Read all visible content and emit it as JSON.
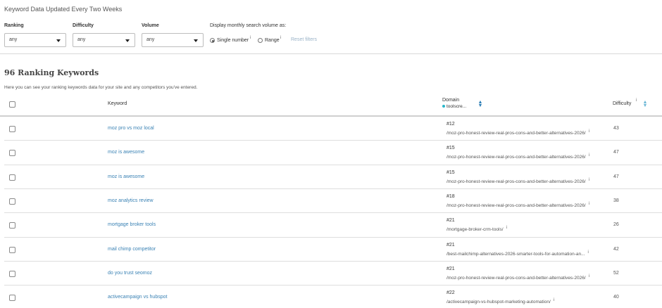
{
  "header": {
    "title": "Keyword Data Updated Every Two Weeks"
  },
  "filters": {
    "ranking": {
      "label": "Ranking",
      "value": "any"
    },
    "difficulty": {
      "label": "Difficulty",
      "value": "any"
    },
    "volume": {
      "label": "Volume",
      "value": "any"
    },
    "display_label": "Display monthly search volume as:",
    "single_number": "Single number",
    "range": "Range",
    "info": "i",
    "reset": "Reset filters"
  },
  "section": {
    "title": "96 Ranking Keywords",
    "description": "Here you can see your ranking keywords data for your site and any competitors you've entered."
  },
  "table": {
    "headers": {
      "keyword": "Keyword",
      "domain": "Domain",
      "domain_sub": "toolscre...",
      "difficulty": "Difficulty"
    },
    "rows": [
      {
        "keyword": "moz pro vs moz local",
        "rank": "#12",
        "url": "/moz-pro-honest-review-real-pros-cons-and-better-alternatives-2026/",
        "difficulty": "43"
      },
      {
        "keyword": "moz is awesome",
        "rank": "#15",
        "url": "/moz-pro-honest-review-real-pros-cons-and-better-alternatives-2026/",
        "difficulty": "47"
      },
      {
        "keyword": "moz is awesome",
        "rank": "#15",
        "url": "/moz-pro-honest-review-real-pros-cons-and-better-alternatives-2026/",
        "difficulty": "47"
      },
      {
        "keyword": "moz analytics review",
        "rank": "#18",
        "url": "/moz-pro-honest-review-real-pros-cons-and-better-alternatives-2026/",
        "difficulty": "38"
      },
      {
        "keyword": "mortgage broker tools",
        "rank": "#21",
        "url": "/mortgage-broker-crm-tools/",
        "difficulty": "26"
      },
      {
        "keyword": "mail chimp competitor",
        "rank": "#21",
        "url": "/best-mailchimp-alternatives-2026-smarter-tools-for-automation-an...",
        "difficulty": "42"
      },
      {
        "keyword": "do you trust seomoz",
        "rank": "#21",
        "url": "/moz-pro-honest-review-real-pros-cons-and-better-alternatives-2026/",
        "difficulty": "52"
      },
      {
        "keyword": "activecampaign vs hubspot",
        "rank": "#22",
        "url": "/activecampaign-vs-hubspot-marketing-automation/",
        "difficulty": "40"
      }
    ]
  }
}
